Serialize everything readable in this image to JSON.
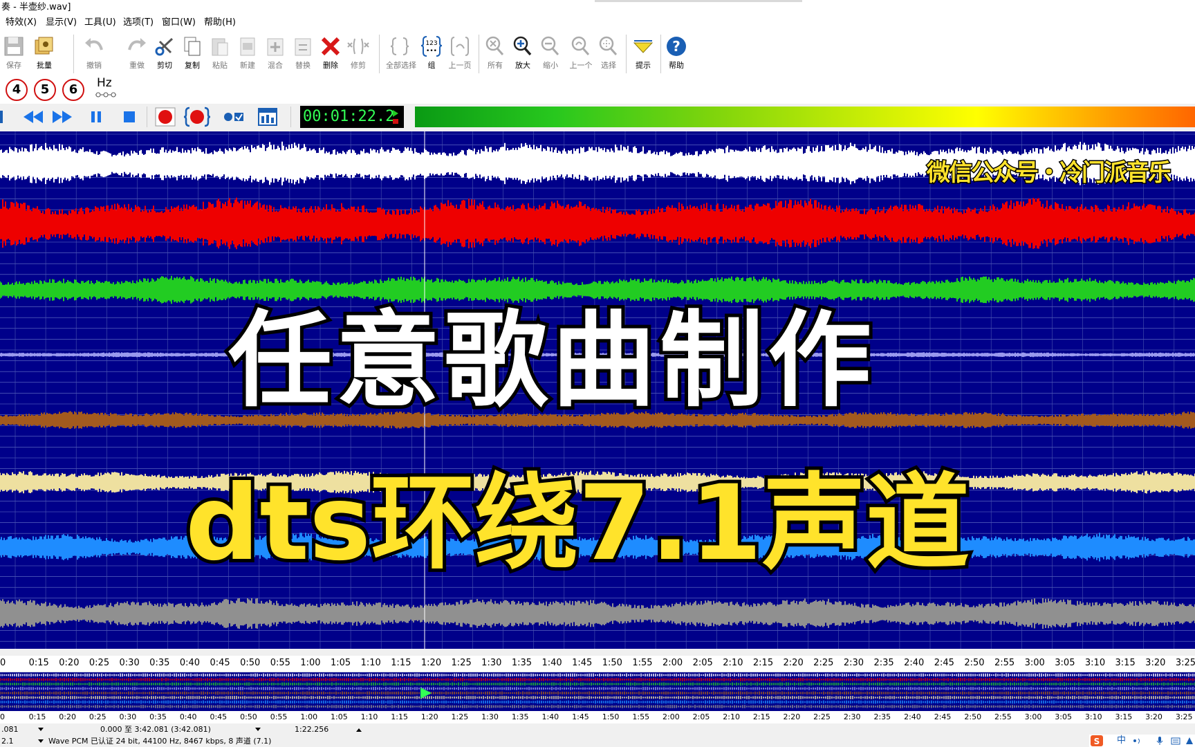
{
  "window": {
    "title": "奏 - 半壶纱.wav]"
  },
  "menu": [
    "特效(X)",
    "显示(V)",
    "工具(U)",
    "选项(T)",
    "窗口(W)",
    "帮助(H)"
  ],
  "toolbar": [
    {
      "label": "保存",
      "icon": "save-icon"
    },
    {
      "label": "批量",
      "icon": "batch-icon"
    },
    {
      "label": "撤销",
      "icon": "undo-icon"
    },
    {
      "label": "重做",
      "icon": "redo-icon"
    },
    {
      "label": "剪切",
      "icon": "cut-icon"
    },
    {
      "label": "复制",
      "icon": "copy-icon"
    },
    {
      "label": "粘贴",
      "icon": "paste-icon"
    },
    {
      "label": "新建",
      "icon": "new-icon"
    },
    {
      "label": "混合",
      "icon": "mix-icon"
    },
    {
      "label": "替换",
      "icon": "replace-icon"
    },
    {
      "label": "删除",
      "icon": "delete-icon"
    },
    {
      "label": "修剪",
      "icon": "trim-icon"
    },
    {
      "label": "全部选择",
      "icon": "select-all-icon"
    },
    {
      "label": "组",
      "icon": "group-icon"
    },
    {
      "label": "上一页",
      "icon": "prev-page-icon"
    },
    {
      "label": "所有",
      "icon": "zoom-all-icon"
    },
    {
      "label": "放大",
      "icon": "zoom-in-icon"
    },
    {
      "label": "缩小",
      "icon": "zoom-out-icon"
    },
    {
      "label": "上一个",
      "icon": "zoom-prev-icon"
    },
    {
      "label": "选择",
      "icon": "zoom-select-icon"
    },
    {
      "label": "提示",
      "icon": "hint-icon"
    },
    {
      "label": "帮助",
      "icon": "help-icon"
    }
  ],
  "channels": {
    "ch4": "4",
    "ch5": "5",
    "ch6": "6",
    "hz": "Hz"
  },
  "transport": {
    "time": "00:01:22.2"
  },
  "colors": {
    "waveform_bg": "#00008a",
    "ch1": "#ffffff",
    "ch2": "#ee0000",
    "ch3": "#22cc22",
    "ch4": "#9a9aee",
    "ch5": "#a35a1e",
    "ch6": "#eee0a0",
    "ch7": "#1e8cff",
    "ch8": "#909090"
  },
  "overlay": {
    "title_line1": "任意歌曲制作",
    "title_line2": "dts环绕7.1声道",
    "watermark": "微信公众号・冷门派音乐"
  },
  "ruler_labels": [
    "0",
    "0:15",
    "0:20",
    "0:25",
    "0:30",
    "0:35",
    "0:40",
    "0:45",
    "0:50",
    "0:55",
    "1:00",
    "1:05",
    "1:10",
    "1:15",
    "1:20",
    "1:25",
    "1:30",
    "1:35",
    "1:40",
    "1:45",
    "1:50",
    "1:55",
    "2:00",
    "2:05",
    "2:10",
    "2:15",
    "2:20",
    "2:25",
    "2:30",
    "2:35",
    "2:40",
    "2:45",
    "2:50",
    "2:55",
    "3:00",
    "3:05",
    "3:10",
    "3:15",
    "3:20",
    "3:25"
  ],
  "ruler2_labels": [
    "0",
    "0:15",
    "0:20",
    "0:25",
    "0:30",
    "0:35",
    "0:40",
    "0:45",
    "0:50",
    "0:55",
    "1:00",
    "1:05",
    "1:10",
    "1:15",
    "1:20",
    "1:25",
    "1:30",
    "1:35",
    "1:40",
    "1:45",
    "1:50",
    "1:55",
    "2:00",
    "2:05",
    "2:10",
    "2:15",
    "2:20",
    "2:25",
    "2:30",
    "2:35",
    "2:40",
    "2:45",
    "2:50",
    "2:55",
    "3:00",
    "3:05",
    "3:10",
    "3:15",
    "3:20",
    "3:25"
  ],
  "status": {
    "left_value": ".081",
    "selection": "0.000 至 3:42.081 (3:42.081)",
    "cursor": "1:22.256",
    "left_value2": "2.1",
    "format": "Wave PCM 已认证 24 bit, 44100 Hz, 8467 kbps, 8 声道 (7.1)"
  },
  "tray": {
    "ime": "中"
  }
}
